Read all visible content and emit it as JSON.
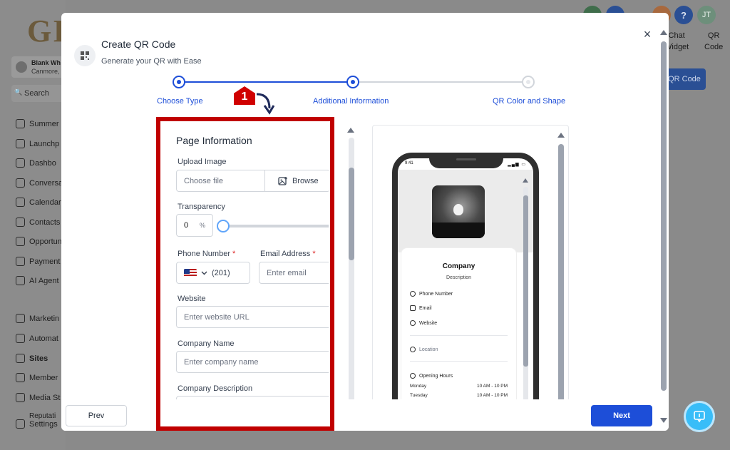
{
  "background": {
    "logo_text": "GI",
    "account": {
      "name": "Blank Wh",
      "location": "Canmore,"
    },
    "search_label": "Search",
    "nav_items": [
      {
        "label": "Summer"
      },
      {
        "label": "Launchp"
      },
      {
        "label": "Dashbo"
      },
      {
        "label": "Conversa"
      },
      {
        "label": "Calendar"
      },
      {
        "label": "Contacts"
      },
      {
        "label": "Opportun"
      },
      {
        "label": "Payment"
      },
      {
        "label": "AI Agent"
      },
      {
        "label": "Marketin"
      },
      {
        "label": "Automat"
      },
      {
        "label": "Sites"
      },
      {
        "label": "Member"
      },
      {
        "label": "Media St"
      },
      {
        "label": "Reputati"
      },
      {
        "label": "Settings"
      }
    ],
    "top_labels": {
      "chat_widget_line1": "Chat",
      "chat_widget_line2": "Widget",
      "qr_code_line1": "QR",
      "qr_code_line2": "Code"
    },
    "avatar_initials": "JT",
    "help_glyph": "?",
    "qr_code_button": "QR Code"
  },
  "modal": {
    "title": "Create QR Code",
    "subtitle": "Generate your QR with Ease",
    "close_glyph": "×",
    "steps": [
      {
        "label": "Choose Type",
        "state": "complete"
      },
      {
        "label": "Additional Information",
        "state": "current"
      },
      {
        "label": "QR Color and Shape",
        "state": "upcoming"
      }
    ],
    "form": {
      "title": "Page Information",
      "upload_label": "Upload Image",
      "choose_file": "Choose file",
      "browse": "Browse",
      "transparency_label": "Transparency",
      "transparency_value": "0",
      "transparency_unit": "%",
      "phone_label": "Phone Number",
      "phone_value": "(201)",
      "email_label": "Email Address",
      "email_placeholder": "Enter email",
      "website_label": "Website",
      "website_placeholder": "Enter website URL",
      "company_name_label": "Company Name",
      "company_name_placeholder": "Enter company name",
      "company_desc_label": "Company Description",
      "required_mark": "*"
    },
    "preview": {
      "time": "9:41",
      "company": "Company",
      "description": "Description",
      "phone_row": "Phone Number",
      "email_row": "Email",
      "website_row": "Website",
      "location_row": "Location",
      "hours_title": "Opening Hours",
      "hours": [
        {
          "day": "Monday",
          "time": "10 AM - 10 PM"
        },
        {
          "day": "Tuesday",
          "time": "10 AM - 10 PM"
        }
      ]
    },
    "prev_button": "Prev",
    "next_button": "Next"
  },
  "annotation": {
    "number": "1",
    "color": "#c00000"
  },
  "colors": {
    "accent": "#1d4ed8",
    "highlight": "#c00000"
  }
}
